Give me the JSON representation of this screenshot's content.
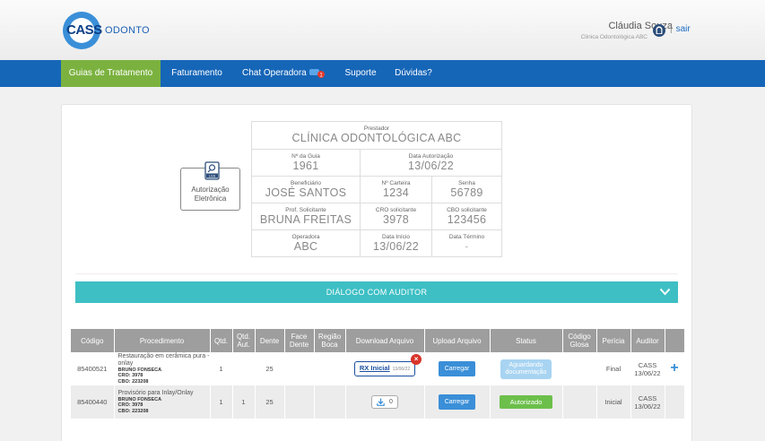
{
  "header": {
    "logo_main": "CASS",
    "logo_sub": "ODONTO",
    "user_name": "Cláudia Souza",
    "user_clinic": "Clinica Odontológica ABC",
    "separator": "|",
    "logout": "sair"
  },
  "nav": {
    "items": [
      {
        "label": "Guias de Tratamento"
      },
      {
        "label": "Faturamento"
      },
      {
        "label": "Chat Operadora"
      },
      {
        "label": "Suporte"
      },
      {
        "label": "Dúvidas?"
      }
    ],
    "chat_badge_count": "1"
  },
  "auth_button": {
    "icon_text": "LGS",
    "line1": "Autorização",
    "line2": "Eletrônica"
  },
  "info": {
    "prestador_label": "Prestador",
    "prestador": "CLÍNICA ODONTOLÓGICA ABC",
    "guia_label": "Nº da Guia",
    "guia": "1961",
    "data_aut_label": "Data Autorização",
    "data_aut": "13/06/22",
    "benef_label": "Beneficiário",
    "benef": "JOSÉ SANTOS",
    "carteira_label": "Nº Carteira",
    "carteira": "1234",
    "senha_label": "Senha",
    "senha": "56789",
    "prof_label": "Prof. Solicitante",
    "prof": "BRUNA FREITAS",
    "cro_label": "CRO solicitante",
    "cro": "3978",
    "cbo_label": "CBO solicitante",
    "cbo": "123456",
    "oper_label": "Operadora",
    "oper": "ABC",
    "inicio_label": "Data Início",
    "inicio": "13/06/22",
    "termino_label": "Data Término",
    "termino": "-"
  },
  "dialog": {
    "label": "DIÁLOGO COM AUDITOR"
  },
  "table": {
    "headers": [
      "Código",
      "Procedimento",
      "Qtd.",
      "Qtd. Aut.",
      "Dente",
      "Face Dente",
      "Região Boca",
      "Download Arquivo",
      "Upload Arquivo",
      "Status",
      "Código Glosa",
      "Perícia",
      "Auditor",
      ""
    ],
    "rows": [
      {
        "codigo": "85400521",
        "proc_name": "Restauração em cerâmica pura - onlay",
        "prof": "BRUNO FONSECA",
        "cro": "CRO: 3978",
        "cbo": "CBO: 223208",
        "qtd": "1",
        "qtd_aut": "",
        "dente": "25",
        "download_link": "RX Inicial",
        "download_date": "13/06/22",
        "remove": "×",
        "upload": "Carregar",
        "status1": "Aguardando",
        "status2": "documentação",
        "pericia": "Final",
        "auditor": "CASS",
        "auditor_date": "13/06/22",
        "action": "+"
      },
      {
        "codigo": "85400440",
        "proc_name": "Provisório para Inlay/Onlay",
        "prof": "BRUNO FONSECA",
        "cro": "CRO: 3978",
        "cbo": "CBO: 223208",
        "qtd": "1",
        "qtd_aut": "1",
        "dente": "25",
        "download_count": "0",
        "upload": "Carregar",
        "status": "Autorizado",
        "pericia": "Inicial",
        "auditor": "CASS",
        "auditor_date": "13/06/22"
      }
    ]
  },
  "colors": {
    "nav": "#1666b8",
    "nav_active": "#7bb23f",
    "dialog": "#3dbfc4",
    "header_table": "#9e9e9e"
  }
}
